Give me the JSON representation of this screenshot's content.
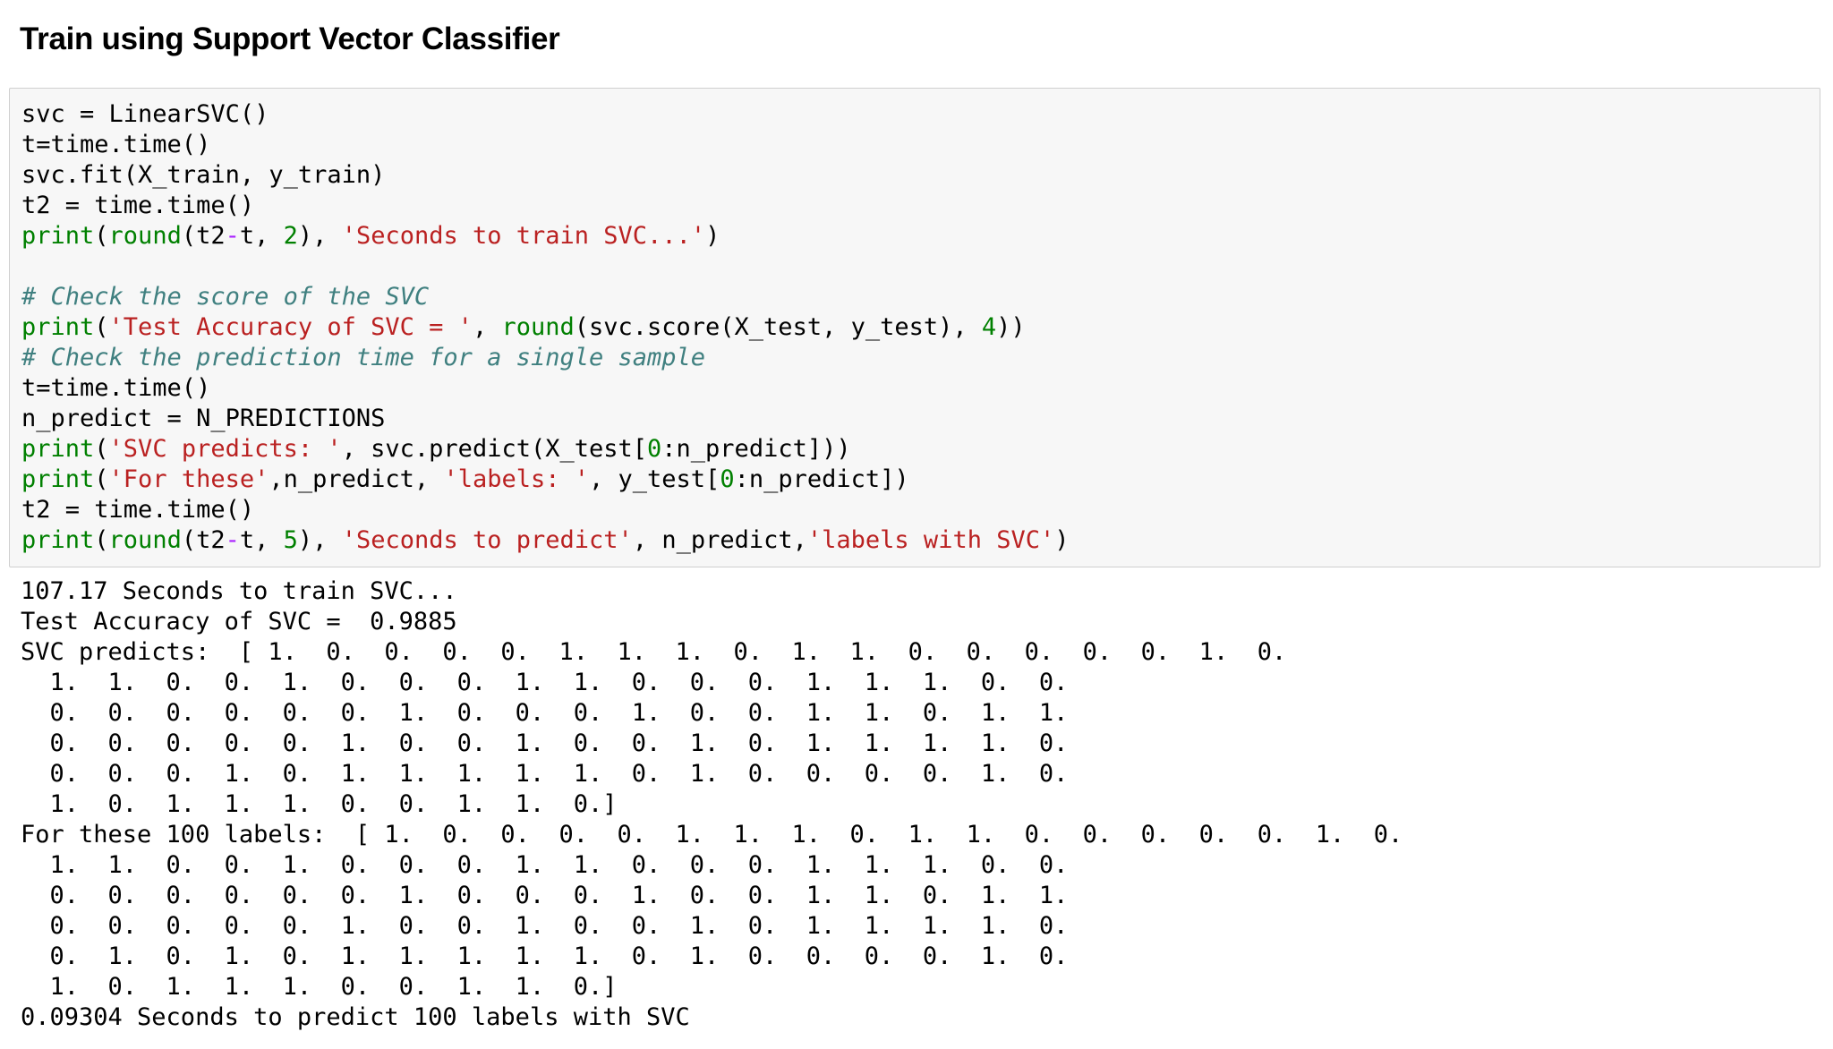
{
  "heading": "Train using Support Vector Classifier",
  "code_lines": [
    [
      {
        "t": "plain",
        "s": "svc = LinearSVC()"
      }
    ],
    [
      {
        "t": "plain",
        "s": "t=time.time()"
      }
    ],
    [
      {
        "t": "plain",
        "s": "svc.fit(X_train, y_train)"
      }
    ],
    [
      {
        "t": "plain",
        "s": "t2 = time.time()"
      }
    ],
    [
      {
        "t": "kw",
        "s": "print"
      },
      {
        "t": "plain",
        "s": "("
      },
      {
        "t": "bi",
        "s": "round"
      },
      {
        "t": "plain",
        "s": "(t2"
      },
      {
        "t": "op",
        "s": "-"
      },
      {
        "t": "plain",
        "s": "t, "
      },
      {
        "t": "num",
        "s": "2"
      },
      {
        "t": "plain",
        "s": "), "
      },
      {
        "t": "str",
        "s": "'Seconds to train SVC...'"
      },
      {
        "t": "plain",
        "s": ")"
      }
    ],
    [
      {
        "t": "plain",
        "s": ""
      }
    ],
    [
      {
        "t": "cm",
        "s": "# Check the score of the SVC"
      }
    ],
    [
      {
        "t": "kw",
        "s": "print"
      },
      {
        "t": "plain",
        "s": "("
      },
      {
        "t": "str",
        "s": "'Test Accuracy of SVC = '"
      },
      {
        "t": "plain",
        "s": ", "
      },
      {
        "t": "bi",
        "s": "round"
      },
      {
        "t": "plain",
        "s": "(svc.score(X_test, y_test), "
      },
      {
        "t": "num",
        "s": "4"
      },
      {
        "t": "plain",
        "s": "))"
      }
    ],
    [
      {
        "t": "cm",
        "s": "# Check the prediction time for a single sample"
      }
    ],
    [
      {
        "t": "plain",
        "s": "t=time.time()"
      }
    ],
    [
      {
        "t": "plain",
        "s": "n_predict = N_PREDICTIONS"
      }
    ],
    [
      {
        "t": "kw",
        "s": "print"
      },
      {
        "t": "plain",
        "s": "("
      },
      {
        "t": "str",
        "s": "'SVC predicts: '"
      },
      {
        "t": "plain",
        "s": ", svc.predict(X_test["
      },
      {
        "t": "num",
        "s": "0"
      },
      {
        "t": "plain",
        "s": ":n_predict]))"
      }
    ],
    [
      {
        "t": "kw",
        "s": "print"
      },
      {
        "t": "plain",
        "s": "("
      },
      {
        "t": "str",
        "s": "'For these'"
      },
      {
        "t": "plain",
        "s": ",n_predict, "
      },
      {
        "t": "str",
        "s": "'labels: '"
      },
      {
        "t": "plain",
        "s": ", y_test["
      },
      {
        "t": "num",
        "s": "0"
      },
      {
        "t": "plain",
        "s": ":n_predict])"
      }
    ],
    [
      {
        "t": "plain",
        "s": "t2 = time.time()"
      }
    ],
    [
      {
        "t": "kw",
        "s": "print"
      },
      {
        "t": "plain",
        "s": "("
      },
      {
        "t": "bi",
        "s": "round"
      },
      {
        "t": "plain",
        "s": "(t2"
      },
      {
        "t": "op",
        "s": "-"
      },
      {
        "t": "plain",
        "s": "t, "
      },
      {
        "t": "num",
        "s": "5"
      },
      {
        "t": "plain",
        "s": "), "
      },
      {
        "t": "str",
        "s": "'Seconds to predict'"
      },
      {
        "t": "plain",
        "s": ", n_predict,"
      },
      {
        "t": "str",
        "s": "'labels with SVC'"
      },
      {
        "t": "plain",
        "s": ")"
      }
    ]
  ],
  "output_lines": [
    "107.17 Seconds to train SVC...",
    "Test Accuracy of SVC =  0.9885",
    "SVC predicts:  [ 1.  0.  0.  0.  0.  1.  1.  1.  0.  1.  1.  0.  0.  0.  0.  0.  1.  0.",
    "  1.  1.  0.  0.  1.  0.  0.  0.  1.  1.  0.  0.  0.  1.  1.  1.  0.  0.",
    "  0.  0.  0.  0.  0.  0.  1.  0.  0.  0.  1.  0.  0.  1.  1.  0.  1.  1.",
    "  0.  0.  0.  0.  0.  1.  0.  0.  1.  0.  0.  1.  0.  1.  1.  1.  1.  0.",
    "  0.  0.  0.  1.  0.  1.  1.  1.  1.  1.  0.  1.  0.  0.  0.  0.  1.  0.",
    "  1.  0.  1.  1.  1.  0.  0.  1.  1.  0.]",
    "For these 100 labels:  [ 1.  0.  0.  0.  0.  1.  1.  1.  0.  1.  1.  0.  0.  0.  0.  0.  1.  0.",
    "  1.  1.  0.  0.  1.  0.  0.  0.  1.  1.  0.  0.  0.  1.  1.  1.  0.  0.",
    "  0.  0.  0.  0.  0.  0.  1.  0.  0.  0.  1.  0.  0.  1.  1.  0.  1.  1.",
    "  0.  0.  0.  0.  0.  1.  0.  0.  1.  0.  0.  1.  0.  1.  1.  1.  1.  0.",
    "  0.  1.  0.  1.  0.  1.  1.  1.  1.  1.  0.  1.  0.  0.  0.  0.  1.  0.",
    "  1.  0.  1.  1.  1.  0.  0.  1.  1.  0.]",
    "0.09304 Seconds to predict 100 labels with SVC"
  ]
}
